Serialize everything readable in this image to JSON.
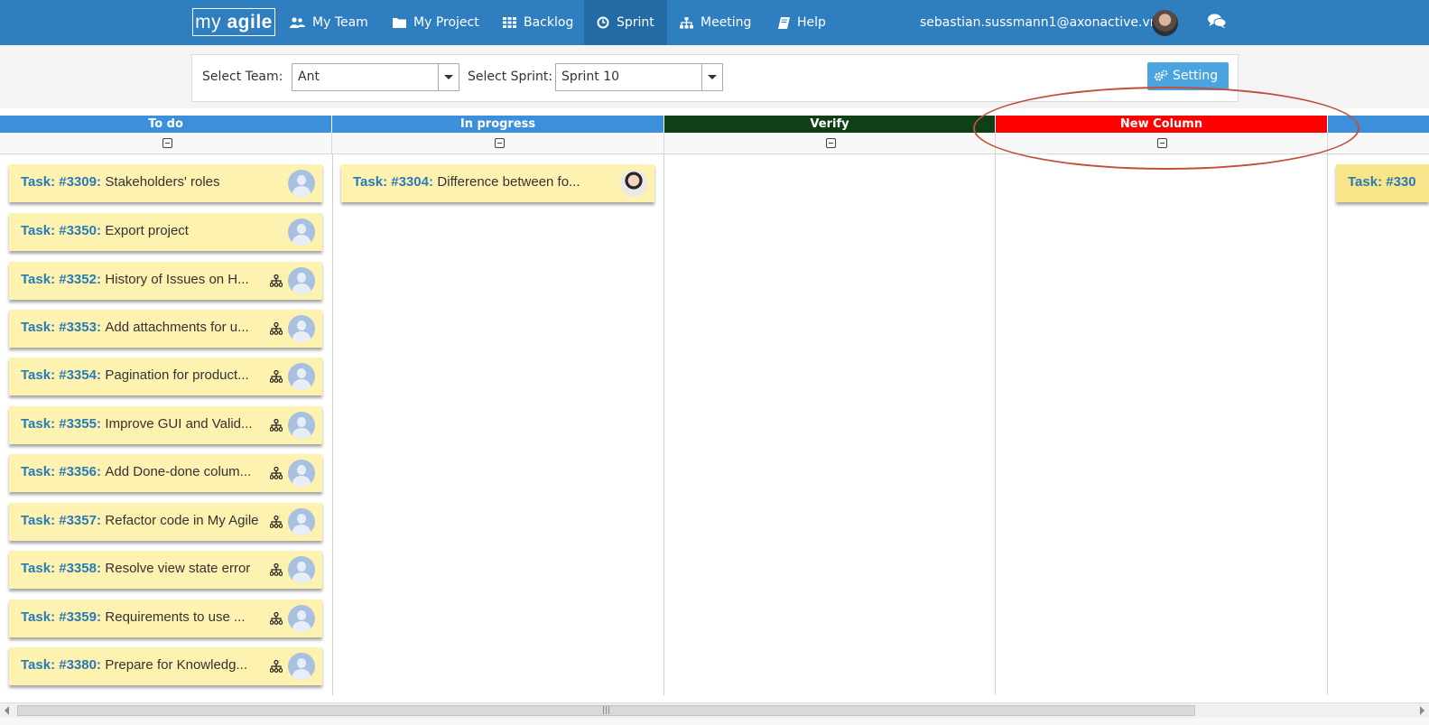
{
  "nav": {
    "logo": {
      "pre": "my ",
      "bold": "agile"
    },
    "items": [
      {
        "label": "My Team",
        "icon": "users-icon"
      },
      {
        "label": "My Project",
        "icon": "folder-icon"
      },
      {
        "label": "Backlog",
        "icon": "grid-icon"
      },
      {
        "label": "Sprint",
        "icon": "clock-icon",
        "active": true
      },
      {
        "label": "Meeting",
        "icon": "sitemap-icon"
      },
      {
        "label": "Help",
        "icon": "book-icon"
      }
    ],
    "user_email": "sebastian.sussmann1@axonactive.vn",
    "colors": {
      "navbar": "#2f7fc0",
      "active": "#246aa5"
    }
  },
  "toolbar": {
    "team_label": "Select Team:",
    "team_value": "Ant",
    "sprint_label": "Select Sprint:",
    "sprint_value": "Sprint 10",
    "setting_label": "Setting"
  },
  "columns": [
    {
      "name": "To do",
      "color": "#3b8fdb"
    },
    {
      "name": "In progress",
      "color": "#3b8fdb"
    },
    {
      "name": "Verify",
      "color": "#0f3f17"
    },
    {
      "name": "New Column",
      "color": "#ff0000"
    },
    {
      "name": "",
      "color": "#3b8fdb"
    }
  ],
  "cards": {
    "todo": [
      {
        "id": "Task: #3309:",
        "title": "Stakeholders' roles",
        "subtasks": false
      },
      {
        "id": "Task: #3350:",
        "title": "Export project",
        "subtasks": false
      },
      {
        "id": "Task: #3352:",
        "title": "History of Issues on H...",
        "subtasks": true
      },
      {
        "id": "Task: #3353:",
        "title": "Add attachments for u...",
        "subtasks": true
      },
      {
        "id": "Task: #3354:",
        "title": "Pagination for product...",
        "subtasks": true
      },
      {
        "id": "Task: #3355:",
        "title": "Improve GUI and Valid...",
        "subtasks": true
      },
      {
        "id": "Task: #3356:",
        "title": "Add Done-done colum...",
        "subtasks": true
      },
      {
        "id": "Task: #3357:",
        "title": "Refactor code in My Agile",
        "subtasks": true
      },
      {
        "id": "Task: #3358:",
        "title": "Resolve view state error",
        "subtasks": true
      },
      {
        "id": "Task: #3359:",
        "title": "Requirements to use ...",
        "subtasks": true
      },
      {
        "id": "Task: #3380:",
        "title": "Prepare for Knowledg...",
        "subtasks": true
      }
    ],
    "in_progress": [
      {
        "id": "Task: #3304:",
        "title": "Difference between fo...",
        "subtasks": false
      }
    ],
    "last": [
      {
        "id": "Task: #330",
        "title": ""
      }
    ]
  }
}
